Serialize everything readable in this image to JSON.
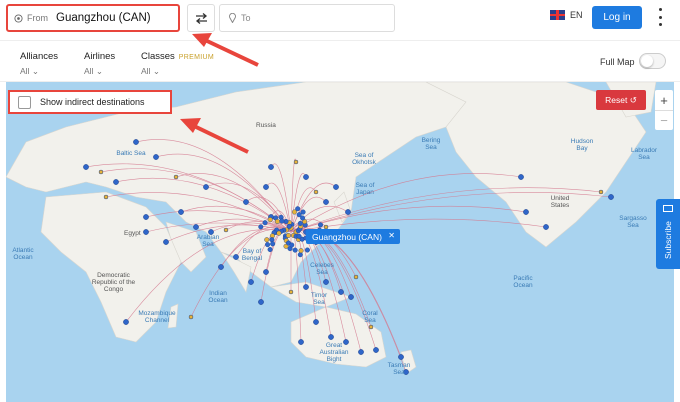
{
  "search": {
    "from_label": "From",
    "from_value": "Guangzhou (CAN)",
    "to_placeholder": "To"
  },
  "header": {
    "language": "EN",
    "login_label": "Log in"
  },
  "filters": [
    {
      "title": "Alliances",
      "value": "All"
    },
    {
      "title": "Airlines",
      "value": "All"
    },
    {
      "title": "Classes",
      "value": "All",
      "badge": "PREMIUM"
    }
  ],
  "fullmap": {
    "label": "Full Map",
    "enabled": false
  },
  "map": {
    "indirect_label": "Show indirect destinations",
    "indirect_checked": false,
    "reset_label": "Reset",
    "zoom_in": "+",
    "zoom_out": "−",
    "origin_tooltip": "Guangzhou (CAN)",
    "tooltip_close": "✕",
    "subscribe_label": "Subscribe",
    "labels": {
      "russia": "Russia",
      "baltic_sea": "Baltic Sea",
      "bering_sea": "Bering Sea",
      "sea_okhotsk": "Sea of Okhotsk",
      "hudson_bay": "Hudson Bay",
      "labrador_sea": "Labrador Sea",
      "united_states": "United States",
      "sargasso_sea": "Sargasso Sea",
      "atlantic": "Atlantic Ocean",
      "egypt": "Egypt",
      "arabian_sea": "Arabian Sea",
      "bay_bengal": "Bay of Bengal",
      "sea_japan": "Sea of Japan",
      "drc": "Democratic Republic of the Congo",
      "indian_ocean": "Indian Ocean",
      "mozambique": "Mozambique Channel",
      "pacific": "Pacific Ocean",
      "celebes": "Celebes Sea",
      "timor": "Timor Sea",
      "coral": "Coral Sea",
      "australian_bight": "Great Australian Bight",
      "tasman": "Tasman Sea"
    },
    "colors": {
      "water": "#a9d3ef",
      "land": "#f2f1ec",
      "route": "#d4788e",
      "direct_dot": "#2f66c9",
      "indirect_dot": "#e6b23a",
      "annotation": "#e8453c"
    }
  }
}
